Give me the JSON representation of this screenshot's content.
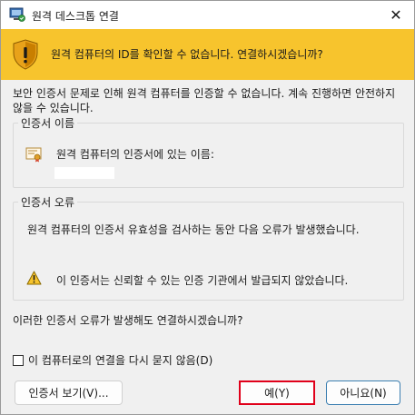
{
  "window": {
    "title": "원격 데스크톱 연결",
    "close_glyph": "✕"
  },
  "banner": {
    "message": "원격 컴퓨터의 ID를 확인할 수 없습니다. 연결하시겠습니까?",
    "color": "#f7c42d"
  },
  "intro": "보안 인증서 문제로 인해 원격 컴퓨터를 인증할 수 없습니다. 계속 진행하면 안전하지 않을 수 있습니다.",
  "certificate_name_group": {
    "legend": "인증서 이름",
    "label": "원격 컴퓨터의 인증서에 있는 이름:"
  },
  "certificate_errors_group": {
    "legend": "인증서 오류",
    "description": "원격 컴퓨터의 인증서 유효성을 검사하는 동안 다음 오류가 발생했습니다.",
    "errors": [
      {
        "icon": "warning-icon",
        "text": "이 인증서는 신뢰할 수 있는 인증 기관에서 발급되지 않았습니다."
      }
    ]
  },
  "question": "이러한 인증서 오류가 발생해도 연결하시겠습니까?",
  "dont_ask_checkbox": {
    "label": "이 컴퓨터로의 연결을 다시 묻지 않음(D)",
    "checked": false
  },
  "buttons": {
    "view_certificate": "인증서 보기(V)...",
    "yes": "예(Y)",
    "no": "아니요(N)"
  },
  "highlight_color": "#e0001a"
}
